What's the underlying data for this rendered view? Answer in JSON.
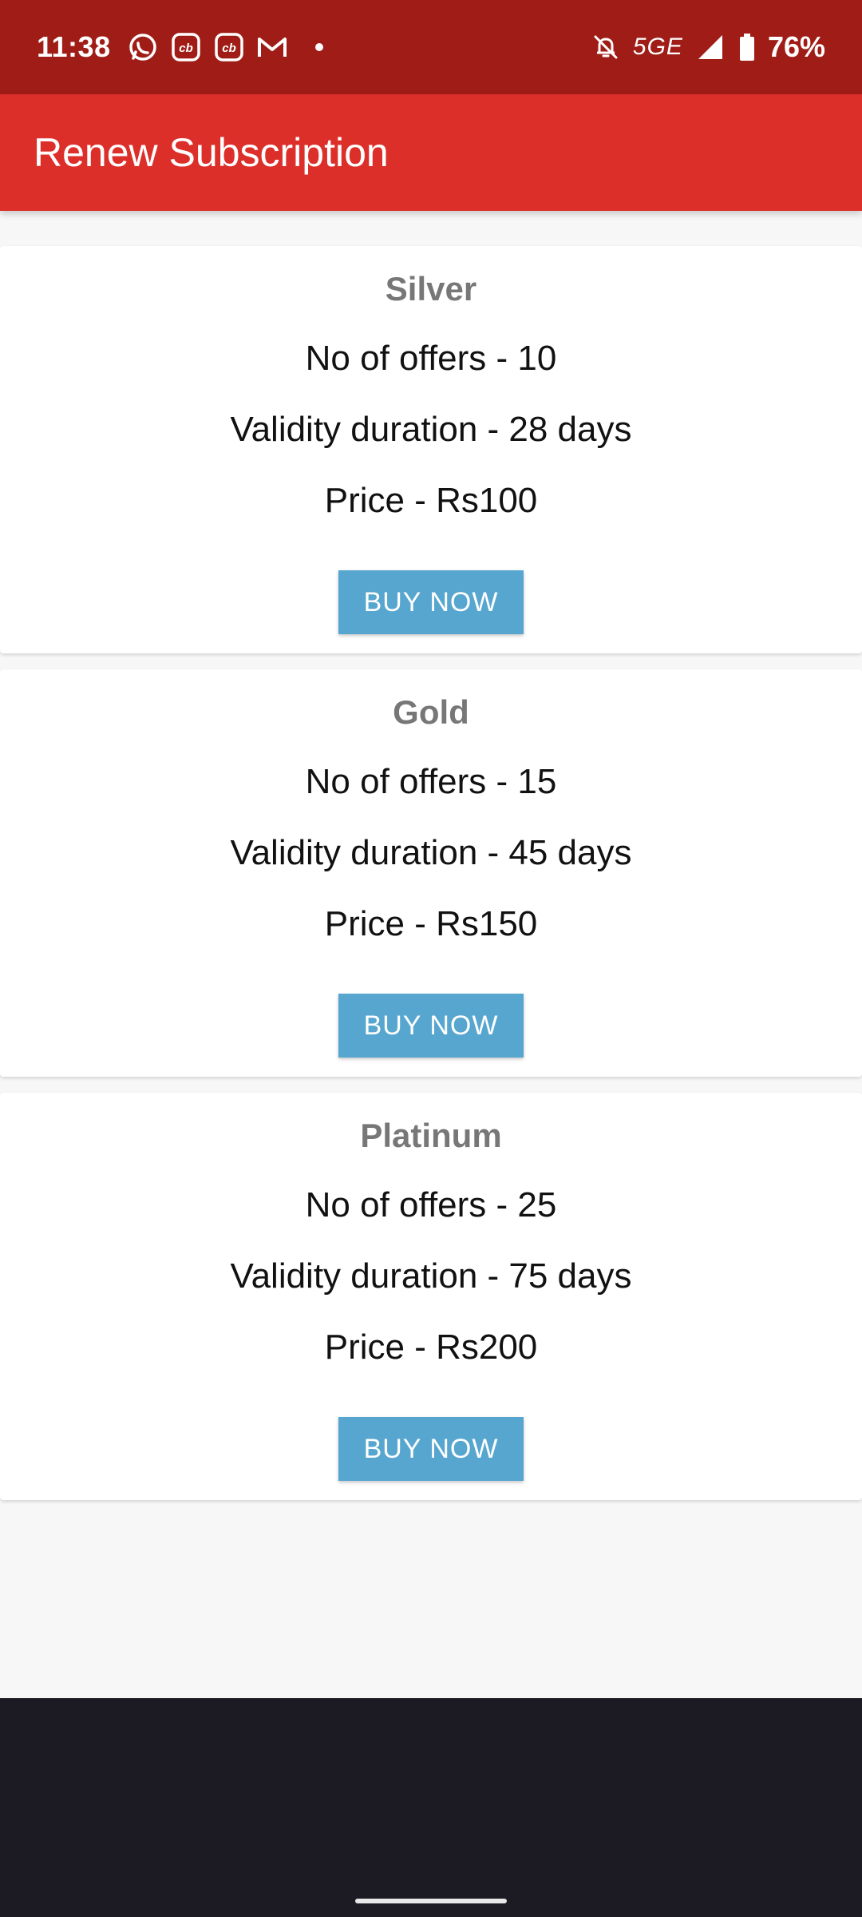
{
  "status_bar": {
    "time": "11:38",
    "network": "5GE",
    "battery": "76%",
    "icons": [
      "whatsapp-icon",
      "cb-app-icon",
      "cb-app-icon",
      "gmail-icon",
      "notification-dot",
      "mute-bell-icon",
      "signal-icon",
      "battery-icon"
    ]
  },
  "app_bar": {
    "title": "Renew Subscription"
  },
  "plans": [
    {
      "name": "Silver",
      "offers": "No of offers - 10",
      "validity": "Validity duration - 28 days",
      "price": "Price - Rs100",
      "button_label": "BUY NOW"
    },
    {
      "name": "Gold",
      "offers": "No of offers - 15",
      "validity": "Validity duration - 45 days",
      "price": "Price - Rs150",
      "button_label": "BUY NOW"
    },
    {
      "name": "Platinum",
      "offers": "No of offers - 25",
      "validity": "Validity duration - 75 days",
      "price": "Price - Rs200",
      "button_label": "BUY NOW"
    }
  ],
  "colors": {
    "status_bar": "#9f1d16",
    "app_bar": "#dc2f2a",
    "button": "#57a6cf",
    "plan_name": "#777777",
    "nav_bar": "#1c1a22"
  }
}
